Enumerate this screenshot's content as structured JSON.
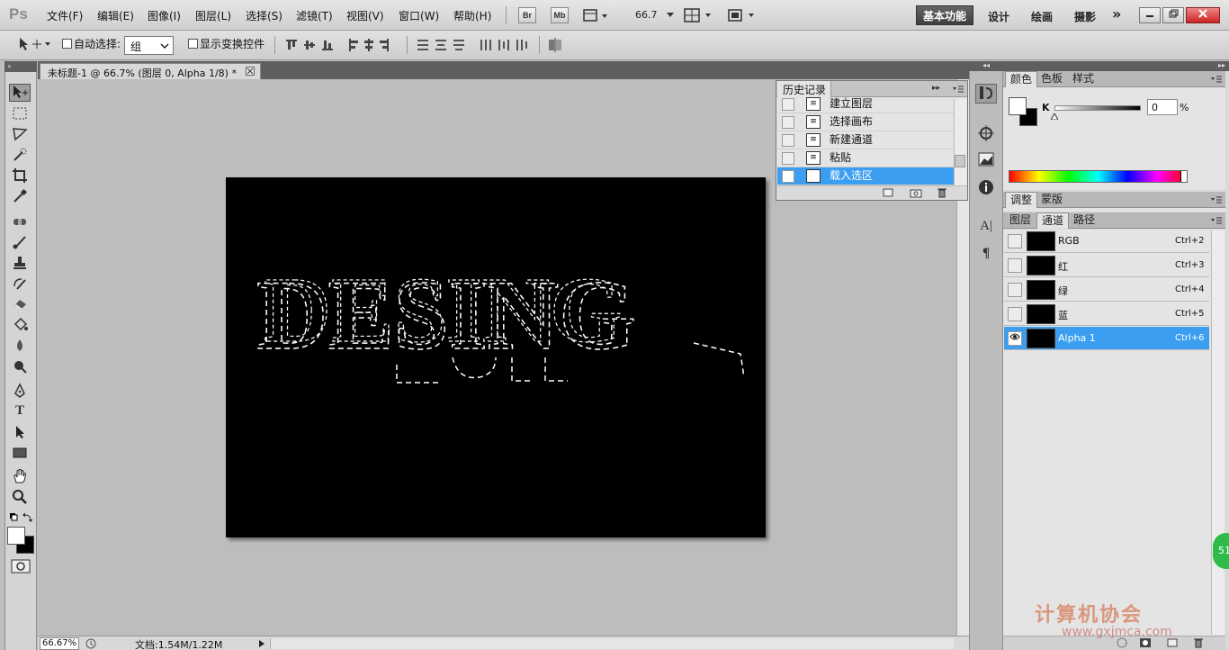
{
  "app": {
    "logo": "Ps"
  },
  "menu": [
    "文件(F)",
    "编辑(E)",
    "图像(I)",
    "图层(L)",
    "选择(S)",
    "滤镜(T)",
    "视图(V)",
    "窗口(W)",
    "帮助(H)"
  ],
  "appbar": {
    "br": "Br",
    "mb": "Mb",
    "zoom": "66.7"
  },
  "workspaces": {
    "active": "基本功能",
    "items": [
      "设计",
      "绘画",
      "摄影"
    ],
    "more": "»"
  },
  "options": {
    "auto_select_label": "自动选择:",
    "auto_select_checked": false,
    "group_value": "组",
    "show_transform_label": "显示变换控件",
    "show_transform_checked": false
  },
  "document": {
    "tab_title": "未标题-1 @ 66.7% (图层 0, Alpha 1/8) *",
    "status_zoom": "66.67%",
    "status_doc": "文档:1.54M/1.22M"
  },
  "history": {
    "title": "历史记录",
    "items": [
      {
        "label": "建立图层"
      },
      {
        "label": "选择画布"
      },
      {
        "label": "新建通道"
      },
      {
        "label": "粘贴"
      },
      {
        "label": "载入选区"
      }
    ],
    "selected_index": 4
  },
  "color_panel": {
    "tabs": [
      "颜色",
      "色板",
      "样式"
    ],
    "active_tab": "颜色",
    "k_label": "K",
    "k_value": "0",
    "k_unit": "%"
  },
  "adjust_panel": {
    "tabs": [
      "调整",
      "蒙版"
    ],
    "active_tab": "调整"
  },
  "channel_panel": {
    "tabs": [
      "图层",
      "通道",
      "路径"
    ],
    "active_tab": "通道",
    "channels": [
      {
        "name": "RGB",
        "shortcut": "Ctrl+2",
        "visible": false
      },
      {
        "name": "红",
        "shortcut": "Ctrl+3",
        "visible": false
      },
      {
        "name": "绿",
        "shortcut": "Ctrl+4",
        "visible": false
      },
      {
        "name": "蓝",
        "shortcut": "Ctrl+5",
        "visible": false
      },
      {
        "name": "Alpha 1",
        "shortcut": "Ctrl+6",
        "visible": true
      }
    ],
    "selected_index": 4
  },
  "canvas": {
    "text": "DESING",
    "selection_style": "marching-ants"
  },
  "watermark": {
    "text": "计算机协会",
    "url": "www.gxjmca.com"
  },
  "badge": "51",
  "colors": {
    "accent": "#3b9ef0",
    "canvas": "#000000",
    "workspace_bg": "#bdbdbd"
  }
}
